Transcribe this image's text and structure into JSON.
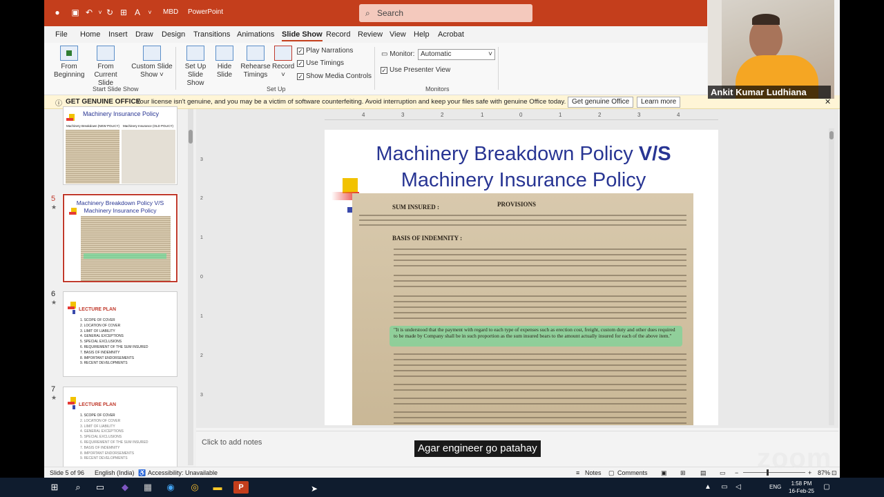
{
  "titlebar": {
    "filename": "MBD",
    "app": "PowerPoint",
    "search_placeholder": "Search"
  },
  "menu": [
    "File",
    "Home",
    "Insert",
    "Draw",
    "Design",
    "Transitions",
    "Animations",
    "Slide Show",
    "Record",
    "Review",
    "View",
    "Help",
    "Acrobat"
  ],
  "menu_active": "Slide Show",
  "ribbon": {
    "from_beginning_1": "From",
    "from_beginning_2": "Beginning",
    "from_current_1": "From",
    "from_current_2": "Current Slide",
    "custom_1": "Custom Slide",
    "custom_2": "Show ˅",
    "group_start": "Start Slide Show",
    "setup_1": "Set Up",
    "setup_2": "Slide Show",
    "hide_1": "Hide",
    "hide_2": "Slide",
    "rehearse_1": "Rehearse",
    "rehearse_2": "Timings",
    "record_1": "Record",
    "record_2": "˅",
    "play_narrations": "Play Narrations",
    "use_timings": "Use Timings",
    "show_media_controls": "Show Media Controls",
    "group_setup": "Set Up",
    "monitor_label": "Monitor:",
    "monitor_value": "Automatic",
    "use_presenter_view": "Use Presenter View",
    "group_monitors": "Monitors"
  },
  "warning": {
    "title": "GET GENUINE OFFICE",
    "message": "Your license isn't genuine, and you may be a victim of software counterfeiting. Avoid interruption and keep your files safe with genuine Office today.",
    "button_genuine": "Get genuine Office",
    "button_learn": "Learn more"
  },
  "thumbnails": {
    "slide4_title": "Machinery Insurance Policy",
    "slide4_left_label": "Machinery Breakdown (NEW POLICY)",
    "slide4_right_label": "Machinery Insurance (OLD POLICY)",
    "slide5_num": "5",
    "slide5_title_1": "Machinery Breakdown Policy V/S",
    "slide5_title_2": "Machinery Insurance Policy",
    "slide6_num": "6",
    "slide7_num": "7",
    "lecture_plan": "LECTURE PLAN",
    "lecture_items": [
      "SCOPE OF COVER",
      "LOCATION OF COVER",
      "LIMIT OF LIABILITY",
      "GENERAL EXCEPTIONS",
      "SPECIAL EXCLUSIONS",
      "REQUIREMENT OF THE SUM INSURED",
      "BASIS OF INDEMNITY",
      "IMPORTANT ENDORSEMENTS",
      "RECENT DEVELOPMENTS"
    ]
  },
  "slide": {
    "title_line1": "Machinery Breakdown Policy",
    "title_vs": "V/S",
    "title_line2": "Machinery Insurance Policy",
    "doc_provisions": "PROVISIONS",
    "doc_sum_insured": "SUM INSURED :",
    "doc_basis": "BASIS OF INDEMNITY :",
    "doc_highlight": "\"It is understood that the payment with regard to each type of expenses such as erection cost, freight, custom duty and other dues required to be made by Company shall be in such proportion as the sum insured bears to the amount actually insured for each of the above item.\""
  },
  "notes_placeholder": "Click to add notes",
  "caption": "Agar engineer go patahay",
  "webcam_name": "Ankit Kumar Ludhiana",
  "statusbar": {
    "slide_of": "Slide 5 of 96",
    "language": "English (India)",
    "accessibility": "Accessibility: Unavailable",
    "notes": "Notes",
    "comments": "Comments",
    "zoom": "87%"
  },
  "taskbar": {
    "lang": "ENG",
    "time": "1:58 PM",
    "date": "16-Feb-25"
  },
  "watermark": "zoom"
}
